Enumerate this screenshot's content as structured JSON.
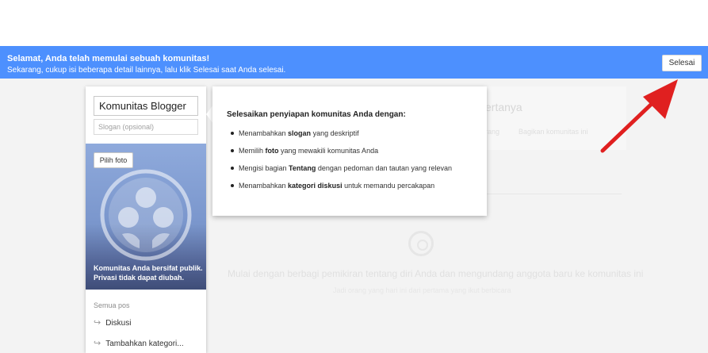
{
  "banner": {
    "title": "Selamat, Anda telah memulai sebuah komunitas!",
    "subtitle": "Sekarang, cukup isi beberapa detail lainnya, lalu klik Selesai saat Anda selesai.",
    "done_label": "Selesai",
    "color": "#4d90fe"
  },
  "community": {
    "name": "Komunitas Blogger",
    "slogan_placeholder": "Slogan (opsional)",
    "photo_button": "Pilih foto",
    "privacy_line1": "Komunitas Anda bersifat publik.",
    "privacy_line2": "Privasi tidak dapat diubah."
  },
  "nav": {
    "header": "Semua pos",
    "items": [
      {
        "label": "Diskusi",
        "icon": "arrow-right-icon"
      },
      {
        "label": "Tambahkan kategori...",
        "icon": "arrow-right-icon"
      }
    ]
  },
  "callout": {
    "heading": "Selesaikan penyiapan komunitas Anda dengan:",
    "items": [
      {
        "pre": "Menambahkan ",
        "bold": "slogan",
        "post": " yang deskriptif"
      },
      {
        "pre": "Memilih ",
        "bold": "foto",
        "post": " yang mewakili komunitas Anda"
      },
      {
        "pre": "Mengisi bagian ",
        "bold": "Tentang",
        "post": " dengan pedoman dan tautan yang relevan"
      },
      {
        "pre": "Menambahkan ",
        "bold": "kategori diskusi",
        "post": " untuk memandu percakapan"
      }
    ]
  },
  "background": {
    "card_title": "ertanya",
    "tab1": "rang",
    "tab2": "Bagikan komunitas ini",
    "empty_text": "Mulai dengan berbagi pemikiran tentang diri Anda dan mengundang anggota baru ke komunitas ini",
    "empty_sub": "Jadi orang yang hari ini dari pertama yang ikut berbicara"
  },
  "colors": {
    "accent": "#4d90fe",
    "annotation_arrow": "#e02020"
  }
}
